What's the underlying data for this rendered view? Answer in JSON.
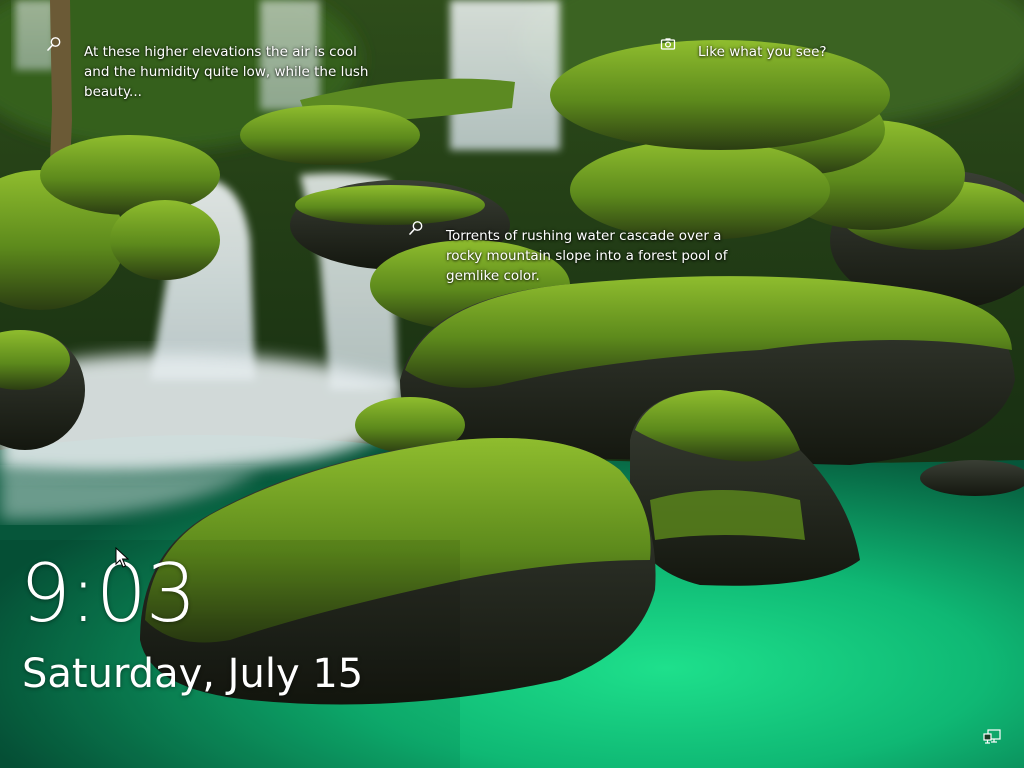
{
  "hotspots": [
    {
      "icon": "search-icon",
      "text": "At these higher elevations the air is cool and the humidity quite low, while the lush beauty..."
    },
    {
      "icon": "camera-icon",
      "text": "Like what you see?"
    },
    {
      "icon": "search-icon",
      "text": "Torrents of rushing water cascade over a rocky mountain slope into a forest pool of gemlike color."
    }
  ],
  "clock": {
    "time": "9:03",
    "date": "Saturday, July 15"
  },
  "status": {
    "network_icon": "network-icon"
  },
  "colors": {
    "moss": "#5d8a1c",
    "pool": "#14c07a",
    "water": "#e7eef0",
    "rock": "#1a1f17"
  }
}
